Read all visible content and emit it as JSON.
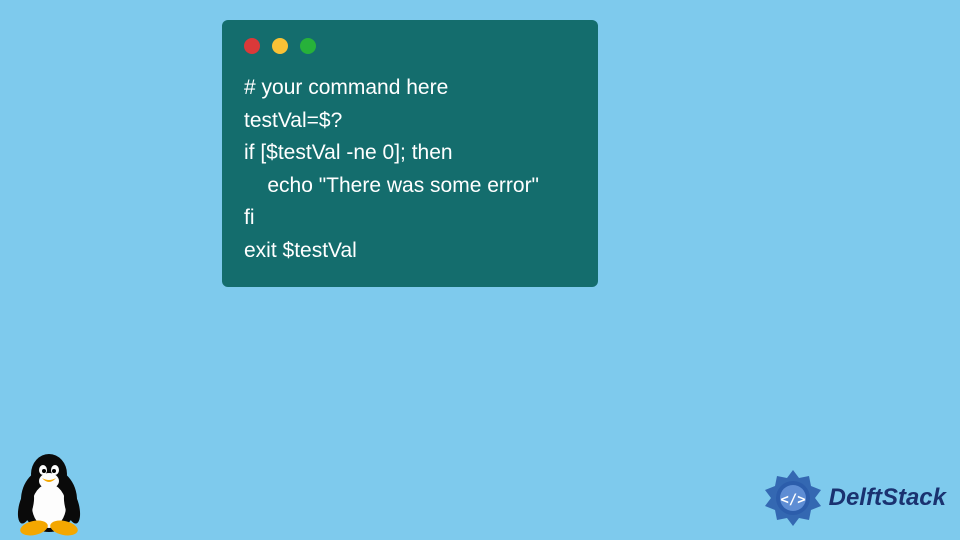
{
  "terminal": {
    "window_controls": {
      "red": "#da3939",
      "yellow": "#f9c235",
      "green": "#27b13a"
    },
    "code_lines": [
      "# your command here",
      "testVal=$?",
      "if [$testVal -ne 0]; then",
      "    echo \"There was some error\"",
      "fi",
      "exit $testVal"
    ]
  },
  "branding": {
    "name": "DelftStack",
    "mascot": "tux-penguin"
  }
}
